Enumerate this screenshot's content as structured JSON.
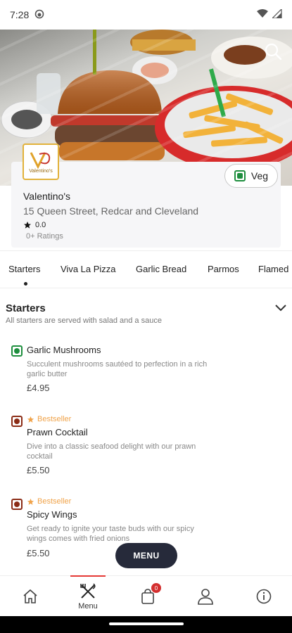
{
  "status_bar": {
    "time": "7:28"
  },
  "restaurant": {
    "logo_text": "Valentino's",
    "name": "Valentino's",
    "address": "15 Queen Street, Redcar and Cleveland",
    "rating": "0.0",
    "rating_count": "0+ Ratings",
    "veg_toggle_label": "Veg"
  },
  "categories": [
    "Starters",
    "Viva La Pizza",
    "Garlic Bread",
    "Parmos",
    "Flamed"
  ],
  "section": {
    "title": "Starters",
    "subtitle": "All starters are served with salad and a sauce"
  },
  "items": [
    {
      "type": "veg",
      "bestseller": "",
      "name": "Garlic Mushrooms",
      "desc": "Succulent mushrooms sautéed to perfection in a rich garlic butter",
      "price": "£4.95"
    },
    {
      "type": "nonveg",
      "bestseller": "Bestseller",
      "name": "Prawn Cocktail",
      "desc": "Dive into a classic seafood delight with our prawn cocktail",
      "price": "£5.50"
    },
    {
      "type": "nonveg",
      "bestseller": "Bestseller",
      "name": "Spicy Wings",
      "desc": "Get ready to ignite your taste buds with our spicy wings comes with fried onions",
      "price": "£5.50"
    }
  ],
  "menu_button": "MENU",
  "bottom_nav": {
    "menu_label": "Menu",
    "cart_count": "0"
  },
  "colors": {
    "accent": "#e53935",
    "veg": "#1e8e3e",
    "nonveg": "#8b2c16",
    "bestseller": "#f0a34a",
    "fab": "#262a3a"
  }
}
